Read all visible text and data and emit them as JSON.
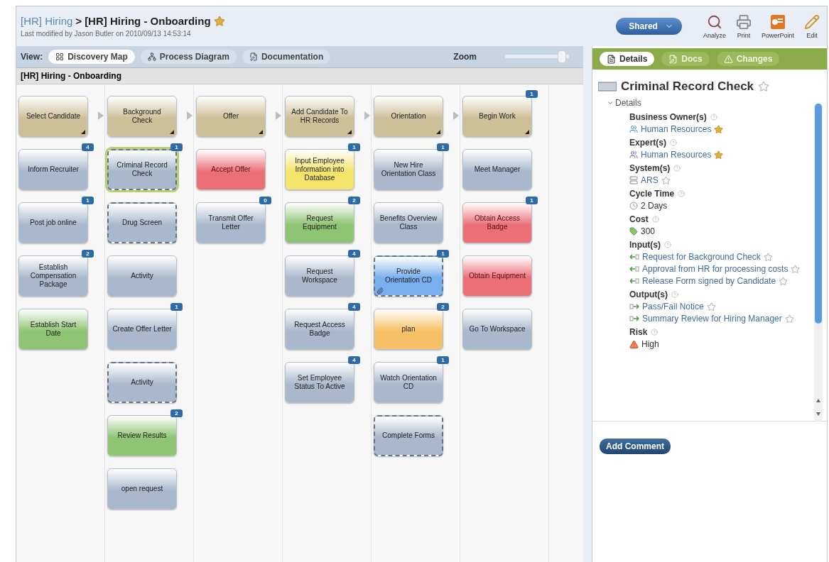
{
  "header": {
    "breadcrumb_parent": "[HR] Hiring",
    "breadcrumb_separator": ">",
    "title": "[HR] Hiring - Onboarding",
    "favorite": true,
    "modified": "Last modified by Jason Butler on 2010/09/13 14:53:14"
  },
  "toolbar": {
    "share": "Shared",
    "actions": [
      {
        "kind": "analyze",
        "label": "Analyze"
      },
      {
        "kind": "print",
        "label": "Print"
      },
      {
        "kind": "powerpoint",
        "label": "PowerPoint"
      },
      {
        "kind": "edit",
        "label": "Edit"
      }
    ]
  },
  "view_bar": {
    "label": "View:",
    "tabs": [
      {
        "kind": "map",
        "label": "Discovery Map",
        "selected": true
      },
      {
        "kind": "diagram",
        "label": "Process Diagram",
        "selected": false
      },
      {
        "kind": "doc",
        "label": "Documentation",
        "selected": false
      }
    ],
    "zoom": {
      "label": "Zoom",
      "level": 0.95
    }
  },
  "map_title": "[HR] Hiring - Onboarding",
  "columns": [
    {
      "cards": [
        {
          "kind": "phase",
          "text": "Select Candidate",
          "color": "#cdbf98",
          "dashed": false,
          "selected": false
        },
        {
          "kind": "activity",
          "text": "Inform Recruiter",
          "color": "#a9b8cc",
          "dashed": false,
          "selected": false,
          "badge": "4"
        },
        {
          "kind": "activity",
          "text": "Post job online",
          "color": "#a9b8cc",
          "dashed": false,
          "selected": false,
          "badge": "1"
        },
        {
          "kind": "activity",
          "text": "Establish Compensation Package",
          "color": "#a9b8cc",
          "dashed": false,
          "selected": false,
          "badge": "2"
        },
        {
          "kind": "activity",
          "text": "Establish Start Date",
          "color": "#8fc474",
          "dashed": false,
          "selected": false
        }
      ]
    },
    {
      "cards": [
        {
          "kind": "phase",
          "text": "Background Check",
          "color": "#cdbf98",
          "dashed": false,
          "selected": false
        },
        {
          "kind": "activity",
          "text": "Criminal Record Check",
          "color": "#a9b8cc",
          "dashed": true,
          "selected": true,
          "badge": "1"
        },
        {
          "kind": "activity",
          "text": "Drug Screen",
          "color": "#a9b8cc",
          "dashed": true,
          "selected": false
        },
        {
          "kind": "activity",
          "text": "Activity",
          "color": "#a9b8cc",
          "dashed": false,
          "selected": false
        },
        {
          "kind": "activity",
          "text": "Create Offer Letter",
          "color": "#a9b8cc",
          "dashed": false,
          "selected": false,
          "badge": "1"
        },
        {
          "kind": "activity",
          "text": "Activity",
          "color": "#a9b8cc",
          "dashed": true,
          "selected": false
        },
        {
          "kind": "activity",
          "text": "Review Results",
          "color": "#8fc474",
          "dashed": false,
          "selected": false,
          "badge": "2"
        },
        {
          "kind": "activity",
          "text": "open request",
          "color": "#a9b8cc",
          "dashed": false,
          "selected": false
        }
      ]
    },
    {
      "cards": [
        {
          "kind": "phase",
          "text": "Offer",
          "color": "#cdbf98",
          "dashed": false,
          "selected": false
        },
        {
          "kind": "activity",
          "text": "Accept Offer",
          "color": "#ec6f78",
          "dashed": false,
          "selected": false
        },
        {
          "kind": "activity",
          "text": "Transmit Offer Letter",
          "color": "#a9b8cc",
          "dashed": false,
          "selected": false,
          "badge": "0"
        }
      ]
    },
    {
      "cards": [
        {
          "kind": "phase",
          "text": "Add Candidate To HR Records",
          "color": "#cdbf98",
          "dashed": false,
          "selected": false
        },
        {
          "kind": "activity",
          "text": "Input Employee Information into Database",
          "color": "#f4e46c",
          "dashed": false,
          "selected": false,
          "badge": "1"
        },
        {
          "kind": "activity",
          "text": "Request Equipment",
          "color": "#8fc474",
          "dashed": false,
          "selected": false,
          "badge": "2"
        },
        {
          "kind": "activity",
          "text": "Request Workspace",
          "color": "#a9b8cc",
          "dashed": false,
          "selected": false,
          "badge": "4"
        },
        {
          "kind": "activity",
          "text": "Request Access Badge",
          "color": "#a9b8cc",
          "dashed": false,
          "selected": false,
          "badge": "4"
        },
        {
          "kind": "activity",
          "text": "Set Employee Status To Active",
          "color": "#a9b8cc",
          "dashed": false,
          "selected": false,
          "badge": "4"
        }
      ]
    },
    {
      "cards": [
        {
          "kind": "phase",
          "text": "Orientation",
          "color": "#cdbf98",
          "dashed": false,
          "selected": false
        },
        {
          "kind": "activity",
          "text": "New Hire Orientation Class",
          "color": "#a9b8cc",
          "dashed": false,
          "selected": false,
          "badge": "1"
        },
        {
          "kind": "activity",
          "text": "Benefits Overview Class",
          "color": "#a9b8cc",
          "dashed": false,
          "selected": false
        },
        {
          "kind": "activity",
          "text": "Provide Orientation CD",
          "color": "#79aef0",
          "dashed": true,
          "selected": false,
          "badge": "1",
          "attachment": true
        },
        {
          "kind": "activity",
          "text": "plan",
          "color": "#f6c166",
          "dashed": false,
          "selected": false,
          "badge": "2"
        },
        {
          "kind": "activity",
          "text": "Watch Orientation CD",
          "color": "#a9b8cc",
          "dashed": false,
          "selected": false,
          "badge": "1"
        },
        {
          "kind": "activity",
          "text": "Complete Forms",
          "color": "#a9b8cc",
          "dashed": true,
          "selected": false
        }
      ]
    },
    {
      "cards": [
        {
          "kind": "phase",
          "text": "Begin Work",
          "color": "#cdbf98",
          "dashed": false,
          "selected": false,
          "badge": "1"
        },
        {
          "kind": "activity",
          "text": "Meet Manager",
          "color": "#a9b8cc",
          "dashed": false,
          "selected": false
        },
        {
          "kind": "activity",
          "text": "Obtain Access Badge",
          "color": "#ec6f78",
          "dashed": false,
          "selected": false,
          "badge": "1"
        },
        {
          "kind": "activity",
          "text": "Obtain Equipment",
          "color": "#ec6f78",
          "dashed": false,
          "selected": false
        },
        {
          "kind": "activity",
          "text": "Go To Workspace",
          "color": "#a9b8cc",
          "dashed": false,
          "selected": false
        }
      ]
    }
  ],
  "panel": {
    "tabs": [
      {
        "kind": "details",
        "label": "Details",
        "selected": true
      },
      {
        "kind": "docs",
        "label": "Docs",
        "selected": false
      },
      {
        "kind": "changes",
        "label": "Changes",
        "selected": false
      }
    ],
    "title": "Criminal Record Check",
    "title_starred": false,
    "section": {
      "label": "Details",
      "expanded": true,
      "fields": [
        {
          "label": "Business Owner(s)",
          "values": [
            {
              "kind": "owner",
              "text": "Human Resources",
              "starred": true
            }
          ]
        },
        {
          "label": "Expert(s)",
          "values": [
            {
              "kind": "expert",
              "text": "Human Resources",
              "starred": true
            }
          ]
        },
        {
          "label": "System(s)",
          "values": [
            {
              "kind": "system",
              "text": "ARS",
              "starred": false
            }
          ]
        },
        {
          "label": "Cycle Time",
          "values": [
            {
              "kind": "time",
              "text": "2 Days"
            }
          ]
        },
        {
          "label": "Cost",
          "values": [
            {
              "kind": "cost",
              "text": "300"
            }
          ]
        },
        {
          "label": "Input(s)",
          "values": [
            {
              "kind": "input",
              "text": "Request for Background Check",
              "starred": false
            },
            {
              "kind": "input",
              "text": "Approval from HR for processing costs",
              "starred": false
            },
            {
              "kind": "input",
              "text": "Release Form signed by Candidate",
              "starred": false
            }
          ]
        },
        {
          "label": "Output(s)",
          "values": [
            {
              "kind": "output",
              "text": "Pass/Fail Notice",
              "starred": false
            },
            {
              "kind": "output",
              "text": "Summary Review for Hiring Manager",
              "starred": false
            }
          ]
        },
        {
          "label": "Risk",
          "values": [
            {
              "kind": "risk",
              "text": "High"
            }
          ]
        }
      ]
    },
    "comment_button": "Add Comment"
  }
}
